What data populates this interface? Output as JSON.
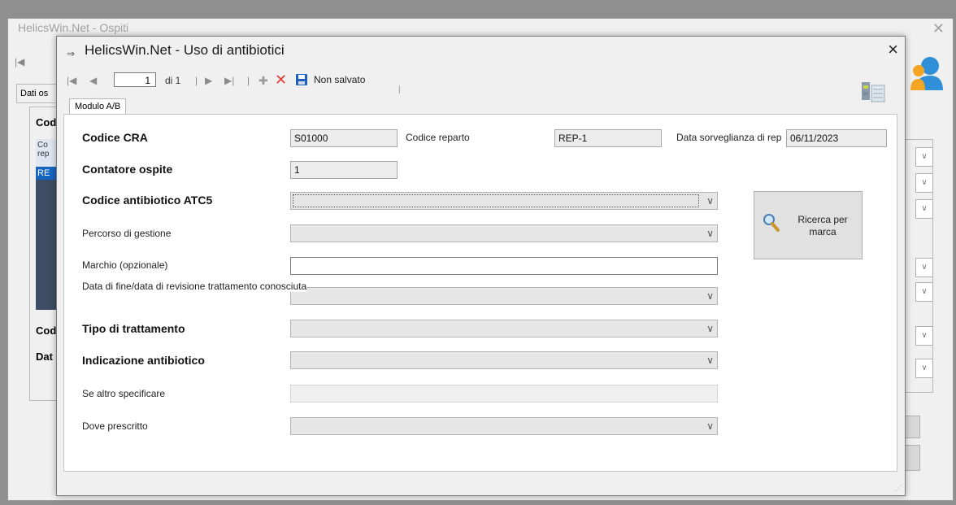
{
  "background_window": {
    "title": "HelicsWin.Net - Ospiti",
    "tab_label": "Dati os",
    "panel_labels": [
      "Cod",
      "Cod",
      "Dat"
    ],
    "list_lines": [
      "Co",
      "rep",
      "RE"
    ]
  },
  "dialog": {
    "title": "HelicsWin.Net - Uso di antibiotici",
    "close_glyph": "×"
  },
  "toolbar": {
    "first_glyph": "|◀",
    "prev_glyph": "◀",
    "record_value": "1",
    "of_label": "di 1",
    "next_glyph": "▶",
    "last_glyph": "▶|",
    "add_glyph": "✚",
    "delete_glyph": "✕",
    "status": "Non salvato"
  },
  "tabs": [
    {
      "label": "Modulo A/B"
    }
  ],
  "form": {
    "codice_cra_label": "Codice CRA",
    "codice_cra_value": "S01000",
    "codice_reparto_label": "Codice reparto",
    "codice_reparto_value": "REP-1",
    "data_sorveglianza_label": "Data sorveglianza di rep",
    "data_sorveglianza_value": "06/11/2023",
    "contatore_label": "Contatore ospite",
    "contatore_value": "1",
    "atc5_label": "Codice antibiotico ATC5",
    "atc5_value": "",
    "percorso_label": "Percorso di gestione",
    "marchio_label": "Marchio (opzionale)",
    "marchio_value": "",
    "data_fine_label": "Data di fine/data di revisione trattamento conosciuta",
    "tipo_label": "Tipo di trattamento",
    "indicazione_label": "Indicazione antibiotico",
    "altro_label": "Se altro specificare",
    "dove_label": "Dove prescritto"
  },
  "search_button": {
    "line1": "Ricerca per",
    "line2": "marca"
  },
  "icons": [
    "first-record-icon",
    "prev-record-icon",
    "next-record-icon",
    "last-record-icon",
    "add-icon",
    "delete-icon",
    "save-icon",
    "database-icon",
    "magnifier-icon",
    "user-icon"
  ],
  "colors": {
    "delete_red": "#e53935",
    "save_blue": "#1f5fbf",
    "list_selected": "#1565c0",
    "user_icon": "#2f8fd8"
  }
}
